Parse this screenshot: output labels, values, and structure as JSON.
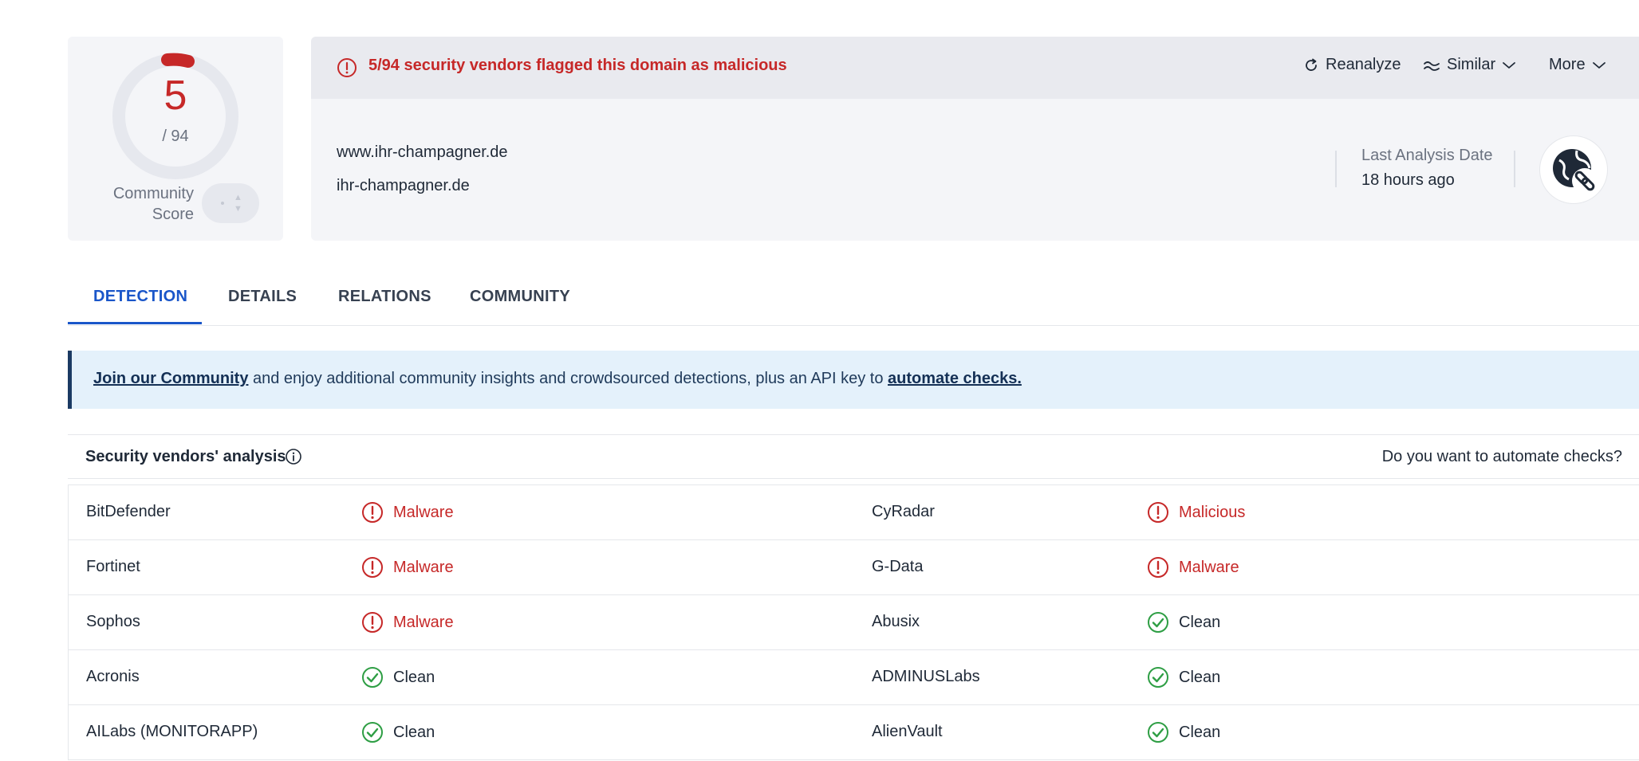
{
  "score": {
    "detections": "5",
    "total": "/ 94",
    "community_label": "Community Score"
  },
  "alert": {
    "text": "5/94 security vendors flagged this domain as malicious"
  },
  "actions": {
    "reanalyze": "Reanalyze",
    "similar": "Similar",
    "more": "More"
  },
  "domain": {
    "host": "www.ihr-champagner.de",
    "root": "ihr-champagner.de"
  },
  "last_analysis": {
    "label": "Last Analysis Date",
    "value": "18 hours ago"
  },
  "tabs": [
    {
      "label": "DETECTION"
    },
    {
      "label": "DETAILS"
    },
    {
      "label": "RELATIONS"
    },
    {
      "label": "COMMUNITY"
    }
  ],
  "banner": {
    "link1": "Join our Community",
    "middle": " and enjoy additional community insights and crowdsourced detections, plus an API key to ",
    "link2": "automate checks."
  },
  "vendors": {
    "title": "Security vendors' analysis",
    "cta": "Do you want to automate checks?",
    "rows": [
      [
        {
          "name": "BitDefender",
          "result": "Malware",
          "status": "malicious"
        },
        {
          "name": "CyRadar",
          "result": "Malicious",
          "status": "malicious"
        }
      ],
      [
        {
          "name": "Fortinet",
          "result": "Malware",
          "status": "malicious"
        },
        {
          "name": "G-Data",
          "result": "Malware",
          "status": "malicious"
        }
      ],
      [
        {
          "name": "Sophos",
          "result": "Malware",
          "status": "malicious"
        },
        {
          "name": "Abusix",
          "result": "Clean",
          "status": "clean"
        }
      ],
      [
        {
          "name": "Acronis",
          "result": "Clean",
          "status": "clean"
        },
        {
          "name": "ADMINUSLabs",
          "result": "Clean",
          "status": "clean"
        }
      ],
      [
        {
          "name": "AILabs (MONITORAPP)",
          "result": "Clean",
          "status": "clean"
        },
        {
          "name": "AlienVault",
          "result": "Clean",
          "status": "clean"
        }
      ]
    ]
  },
  "colors": {
    "malicious": "#c62828",
    "clean": "#2e9e44",
    "accent": "#1a56c9"
  },
  "icons": {
    "alert": "exclamation-circle-icon",
    "reanalyze": "refresh-icon",
    "similar": "similar-icon",
    "chevron": "chevron-down-icon",
    "info": "info-icon",
    "globe": "globe-link-icon",
    "malicious": "exclamation-circle-icon",
    "clean": "check-circle-icon"
  }
}
